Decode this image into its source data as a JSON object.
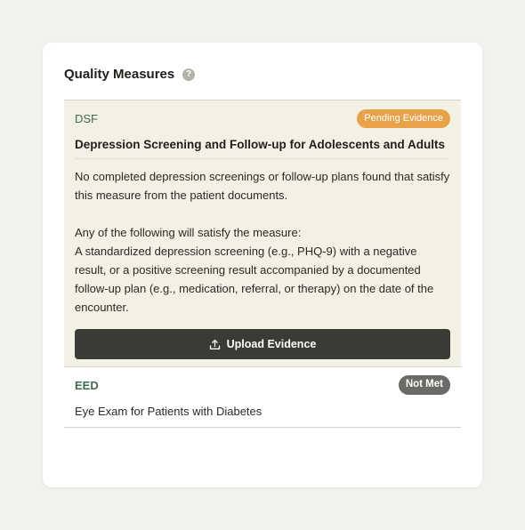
{
  "card": {
    "title": "Quality Measures",
    "help_icon_glyph": "?"
  },
  "measures": [
    {
      "code": "DSF",
      "status": "Pending Evidence",
      "status_color": "#e8a24a",
      "title": "Depression Screening and Follow-up for Adolescents and Adults",
      "description": "No completed depression screenings or follow-up plans found that satisfy this measure from the patient documents.",
      "criteria_heading": "Any of the following will satisfy the measure:",
      "criteria_text": "A standardized depression screening (e.g., PHQ-9) with a negative result, or a positive screening result accompanied by a documented follow-up plan (e.g., medication, referral, or therapy) on the date of the encounter.",
      "action_label": "Upload Evidence",
      "action_icon": "upload-icon"
    },
    {
      "code": "EED",
      "status": "Not Met",
      "status_color": "#6b6a66",
      "title": "Eye Exam for Patients with Diabetes"
    }
  ],
  "colors": {
    "background": "#f2f1ec",
    "card": "#ffffff",
    "active_row": "#f3f0e4",
    "code_green": "#3f6b52",
    "button_dark": "#3a3a36"
  }
}
